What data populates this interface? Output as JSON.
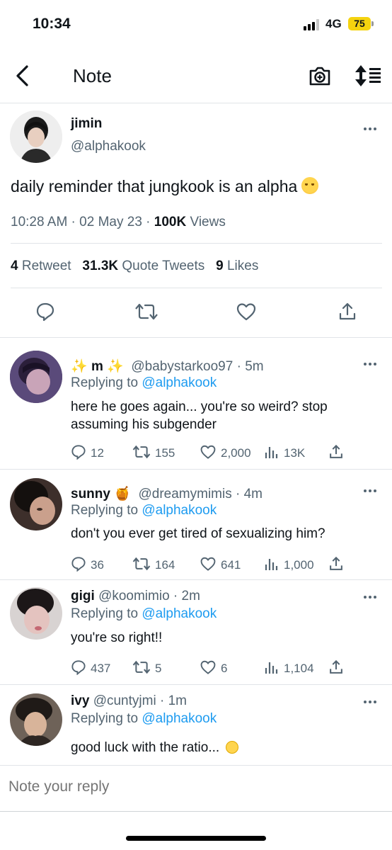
{
  "status": {
    "time": "10:34",
    "network": "4G",
    "battery": "75"
  },
  "nav": {
    "title": "Note"
  },
  "tweet": {
    "name": "jimin",
    "handle": "@alphakook",
    "text": "daily reminder that jungkook is an alpha",
    "time": "10:28 AM",
    "date": "02 May 23",
    "views_count": "100K",
    "views_label": "Views",
    "retweets_count": "4",
    "retweets_label": "Retweet",
    "quotes_count": "31.3K",
    "quotes_label": "Quote Tweets",
    "likes_count": "9",
    "likes_label": "Likes"
  },
  "replies": [
    {
      "name": "m",
      "handle": "@babystarkoo97",
      "age": "5m",
      "replying_prefix": "Replying to",
      "replying_to": "@alphakook",
      "text_lines": [
        "here he goes again... you're so weird? stop",
        "assuming his subgender"
      ],
      "replies": "12",
      "retweets": "155",
      "likes": "2,000",
      "views": "13K"
    },
    {
      "name": "sunny",
      "handle": "@dreamymimis",
      "age": "4m",
      "replying_prefix": "Replying to",
      "replying_to": "@alphakook",
      "text_lines": [
        "don't you ever get tired of sexualizing him?"
      ],
      "replies": "36",
      "retweets": "164",
      "likes": "641",
      "views": "1,000"
    },
    {
      "name": "gigi",
      "handle": "@koomimio",
      "age": "2m",
      "replying_prefix": "Replying to",
      "replying_to": "@alphakook",
      "text_lines": [
        "you're so right!!"
      ],
      "replies": "437",
      "retweets": "5",
      "likes": "6",
      "views": "1,104"
    },
    {
      "name": "ivy",
      "handle": "@cuntyjmi",
      "age": "1m",
      "replying_prefix": "Replying to",
      "replying_to": "@alphakook",
      "text_lines": [
        "good luck with the ratio..."
      ]
    }
  ],
  "compose": {
    "placeholder": "Note your reply"
  },
  "colors": {
    "link": "#1d9bf0",
    "muted": "#536471",
    "battery": "#f5d30f"
  }
}
